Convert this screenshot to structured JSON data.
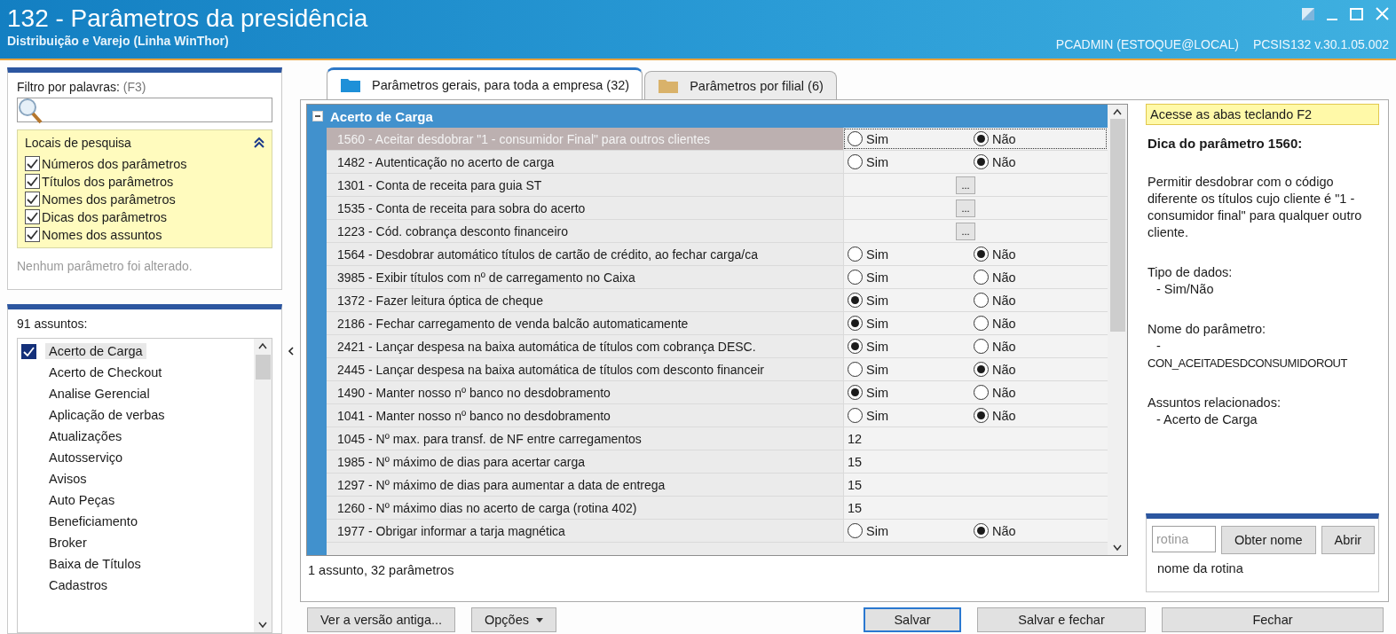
{
  "window": {
    "title": "132 - Parâmetros da presidência",
    "subtitle": "Distribuição e Varejo (Linha WinThor)",
    "user": "PCADMIN (ESTOQUE@LOCAL)",
    "program": "PCSIS132",
    "version": "v.30.1.05.002"
  },
  "filter": {
    "label": "Filtro por palavras:",
    "shortcut": "(F3)",
    "search_places": {
      "title": "Locais de pesquisa",
      "expanded": true,
      "options": [
        {
          "label": "Números dos parâmetros",
          "checked": true
        },
        {
          "label": "Títulos dos parâmetros",
          "checked": true
        },
        {
          "label": "Nomes dos parâmetros",
          "checked": true
        },
        {
          "label": "Dicas dos parâmetros",
          "checked": true
        },
        {
          "label": "Nomes dos assuntos",
          "checked": true
        }
      ]
    },
    "status": "Nenhum parâmetro foi alterado."
  },
  "subjects": {
    "title": "91 assuntos:",
    "items": [
      {
        "label": "Acerto de Carga",
        "checked": true,
        "selected": true
      },
      {
        "label": "Acerto de Checkout",
        "checked": false,
        "selected": false
      },
      {
        "label": "Analise Gerencial",
        "checked": false,
        "selected": false
      },
      {
        "label": "Aplicação de verbas",
        "checked": false,
        "selected": false
      },
      {
        "label": "Atualizações",
        "checked": false,
        "selected": false
      },
      {
        "label": "Autosserviço",
        "checked": false,
        "selected": false
      },
      {
        "label": "Avisos",
        "checked": false,
        "selected": false
      },
      {
        "label": "Auto Peças",
        "checked": false,
        "selected": false
      },
      {
        "label": "Beneficiamento",
        "checked": false,
        "selected": false
      },
      {
        "label": "Broker",
        "checked": false,
        "selected": false
      },
      {
        "label": "Baixa de Títulos",
        "checked": false,
        "selected": false
      },
      {
        "label": "Cadastros",
        "checked": false,
        "selected": false
      }
    ]
  },
  "tabs": [
    {
      "label": "Parâmetros gerais, para toda a empresa  (32)",
      "selected": true,
      "color": "#1e90d8"
    },
    {
      "label": "Parâmetros por filial  (6)",
      "selected": false,
      "color": "#d9b26a"
    }
  ],
  "grid": {
    "group": "Acerto de Carga",
    "expanded": true,
    "rows": [
      {
        "kind": "bool",
        "label": "1560 - Aceitar desdobrar \"1 - consumidor Final\" para outros clientes",
        "selected": true,
        "options": [
          {
            "label": "Sim",
            "selected": false
          },
          {
            "label": "Não",
            "selected": true
          }
        ]
      },
      {
        "kind": "bool",
        "label": "1482 - Autenticação no acerto de carga",
        "selected": false,
        "options": [
          {
            "label": "Sim",
            "selected": false
          },
          {
            "label": "Não",
            "selected": true
          }
        ]
      },
      {
        "kind": "lookup",
        "label": "1301 - Conta de receita para guia ST",
        "selected": false,
        "button": "..."
      },
      {
        "kind": "lookup",
        "label": "1535 - Conta de receita para sobra do acerto",
        "selected": false,
        "button": "..."
      },
      {
        "kind": "lookup",
        "label": "1223 - Cód. cobrança desconto financeiro",
        "selected": false,
        "button": "..."
      },
      {
        "kind": "bool",
        "label": "1564 - Desdobrar automático títulos de cartão de crédito, ao fechar carga/ca",
        "selected": false,
        "options": [
          {
            "label": "Sim",
            "selected": false
          },
          {
            "label": "Não",
            "selected": true
          }
        ]
      },
      {
        "kind": "bool",
        "label": "3985 - Exibir títulos com nº de carregamento no Caixa",
        "selected": false,
        "options": [
          {
            "label": "Sim",
            "selected": false
          },
          {
            "label": "Não",
            "selected": false
          }
        ]
      },
      {
        "kind": "bool",
        "label": "1372 - Fazer leitura óptica de cheque",
        "selected": false,
        "options": [
          {
            "label": "Sim",
            "selected": true
          },
          {
            "label": "Não",
            "selected": false
          }
        ]
      },
      {
        "kind": "bool",
        "label": "2186 - Fechar carregamento de venda balcão automaticamente",
        "selected": false,
        "options": [
          {
            "label": "Sim",
            "selected": true
          },
          {
            "label": "Não",
            "selected": false
          }
        ]
      },
      {
        "kind": "bool",
        "label": "2421 - Lançar despesa na baixa automática de títulos com cobrança DESC.",
        "selected": false,
        "options": [
          {
            "label": "Sim",
            "selected": true
          },
          {
            "label": "Não",
            "selected": false
          }
        ]
      },
      {
        "kind": "bool",
        "label": "2445 - Lançar despesa na baixa automática de títulos com desconto financeir",
        "selected": false,
        "options": [
          {
            "label": "Sim",
            "selected": false
          },
          {
            "label": "Não",
            "selected": true
          }
        ]
      },
      {
        "kind": "bool",
        "label": "1490 - Manter nosso nº banco no desdobramento",
        "selected": false,
        "options": [
          {
            "label": "Sim",
            "selected": true
          },
          {
            "label": "Não",
            "selected": false
          }
        ]
      },
      {
        "kind": "bool",
        "label": "1041 - Manter nosso nº banco no desdobramento",
        "selected": false,
        "options": [
          {
            "label": "Sim",
            "selected": false
          },
          {
            "label": "Não",
            "selected": true
          }
        ]
      },
      {
        "kind": "value",
        "label": "1045 - Nº max. para transf. de NF entre carregamentos",
        "selected": false,
        "value": "12"
      },
      {
        "kind": "value",
        "label": "1985 - Nº máximo de dias para acertar carga",
        "selected": false,
        "value": "15"
      },
      {
        "kind": "value",
        "label": "1297 - Nº máximo de dias para aumentar a data de entrega",
        "selected": false,
        "value": "15"
      },
      {
        "kind": "value",
        "label": "1260 - Nº máximo dias no acerto de carga (rotina 402)",
        "selected": false,
        "value": "15"
      },
      {
        "kind": "bool",
        "label": "1977 - Obrigar informar a tarja magnética",
        "selected": false,
        "options": [
          {
            "label": "Sim",
            "selected": false
          },
          {
            "label": "Não",
            "selected": true
          }
        ]
      }
    ],
    "status": "1 assunto, 32 parâmetros"
  },
  "help": {
    "notice": "Acesse as abas teclando F2",
    "title": "Dica do parâmetro 1560:",
    "description": "Permitir desdobrar com o código diferente os títulos cujo cliente é \"1 - consumidor final\" para qualquer outro cliente.",
    "sections": [
      {
        "heading": "Tipo de dados:",
        "lines": [
          "- Sim/Não"
        ]
      },
      {
        "heading": "Nome do parâmetro:",
        "lines": [
          "-",
          "CON_ACEITADESDCONSUMIDOROUT"
        ]
      },
      {
        "heading": "Assuntos relacionados:",
        "lines": [
          "- Acerto de Carga"
        ]
      }
    ]
  },
  "routine": {
    "placeholder": "rotina",
    "buttons": [
      "Obter nome",
      "Abrir"
    ],
    "result": "nome da rotina"
  },
  "footer": {
    "left_buttons": [
      {
        "label": "Ver a versão antiga...",
        "dropdown": false
      },
      {
        "label": "Opções",
        "dropdown": true
      }
    ],
    "right_buttons": [
      {
        "label": "Salvar",
        "focused": true
      },
      {
        "label": "Salvar e fechar",
        "focused": false
      },
      {
        "label": "Fechar",
        "focused": false
      }
    ]
  }
}
